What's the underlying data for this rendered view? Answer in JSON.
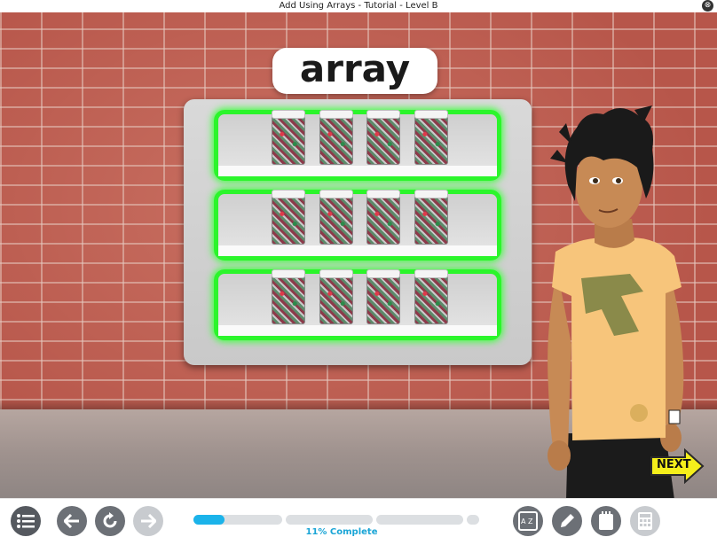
{
  "window": {
    "title": "Add Using Arrays - Tutorial - Level B",
    "close_glyph": "⊗"
  },
  "lesson": {
    "vocab_word": "array",
    "array": {
      "rows": 3,
      "columns": 4,
      "item": "jar",
      "highlight_color": "#2bf52b"
    },
    "character": "tutor-boy"
  },
  "navigation": {
    "next_label": "NEXT"
  },
  "toolbar": {
    "menu_icon": "list-menu-icon",
    "back_icon": "arrow-left-icon",
    "replay_icon": "replay-icon",
    "forward_icon": "arrow-right-icon",
    "glossary_label": "A Z",
    "glossary_icon": "glossary-icon",
    "pencil_icon": "pencil-icon",
    "notepad_icon": "notepad-icon",
    "calculator_icon": "calculator-icon"
  },
  "progress": {
    "percent": 11,
    "label": "11% Complete",
    "segments": 4,
    "color": "#1bb3ea"
  }
}
